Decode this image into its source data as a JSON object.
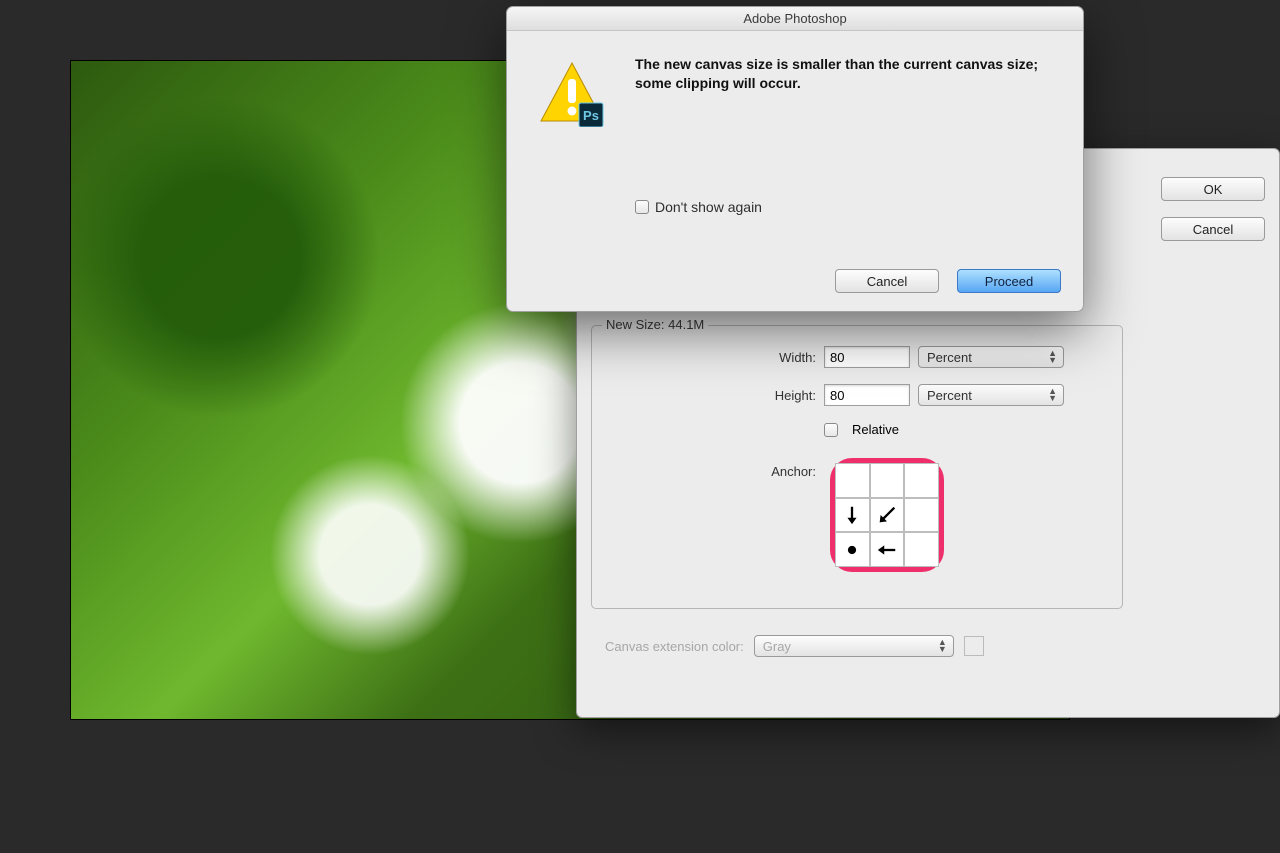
{
  "warning_dialog": {
    "title": "Adobe Photoshop",
    "message": "The new canvas size is smaller than the current canvas size; some clipping will occur.",
    "dont_show_again": "Don't show again",
    "cancel": "Cancel",
    "proceed": "Proceed"
  },
  "canvas_dialog": {
    "ok": "OK",
    "cancel": "Cancel",
    "new_size_label": "New Size: 44.1M",
    "width_label": "Width:",
    "width_value": "80",
    "width_unit": "Percent",
    "height_label": "Height:",
    "height_value": "80",
    "height_unit": "Percent",
    "relative_label": "Relative",
    "anchor_label": "Anchor:",
    "extension_label": "Canvas extension color:",
    "extension_value": "Gray"
  }
}
